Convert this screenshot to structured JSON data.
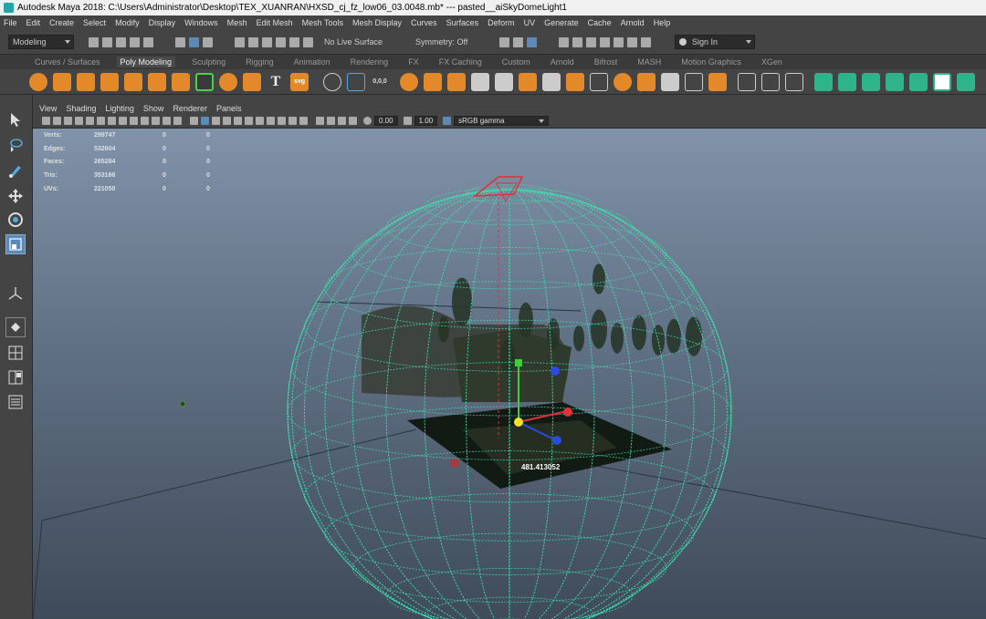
{
  "app": {
    "title": "Autodesk Maya 2018: C:\\Users\\Administrator\\Desktop\\TEX_XUANRAN\\HXSD_cj_fz_low06_03.0048.mb*   ---   pasted__aiSkyDomeLight1"
  },
  "menubar": {
    "items": [
      "File",
      "Edit",
      "Create",
      "Select",
      "Modify",
      "Display",
      "Windows",
      "Mesh",
      "Edit Mesh",
      "Mesh Tools",
      "Mesh Display",
      "Curves",
      "Surfaces",
      "Deform",
      "UV",
      "Generate",
      "Cache",
      "Arnold",
      "Help"
    ]
  },
  "statusline": {
    "menu_set": "Modeling",
    "live_surface": "No Live Surface",
    "symmetry": "Symmetry: Off",
    "sign_in": "Sign In"
  },
  "shelf": {
    "tabs": [
      "Curves / Surfaces",
      "Poly Modeling",
      "Sculpting",
      "Rigging",
      "Animation",
      "Rendering",
      "FX",
      "FX Caching",
      "Custom",
      "Arnold",
      "Bifrost",
      "MASH",
      "Motion Graphics",
      "XGen"
    ],
    "active_tab": "Poly Modeling",
    "text_icon": "T",
    "svg_icon": "svg",
    "zero_icon": "0,0,0"
  },
  "panel": {
    "menus": [
      "View",
      "Shading",
      "Lighting",
      "Show",
      "Renderer",
      "Panels"
    ],
    "exposure": "0.00",
    "gamma": "1.00",
    "colorspace": "sRGB gamma"
  },
  "hud": {
    "rows": [
      {
        "label": "Verts:",
        "v1": "299747",
        "v2": "0",
        "v3": "0"
      },
      {
        "label": "Edges:",
        "v1": "532604",
        "v2": "0",
        "v3": "0"
      },
      {
        "label": "Faces:",
        "v1": "265284",
        "v2": "0",
        "v3": "0"
      },
      {
        "label": "Tris:",
        "v1": "353166",
        "v2": "0",
        "v3": "0"
      },
      {
        "label": "UVs:",
        "v1": "221050",
        "v2": "0",
        "v3": "0"
      }
    ]
  },
  "viewport": {
    "measure": "481.413052",
    "sphere_color": "#3fe0b0",
    "light_color": "#e0303a"
  }
}
